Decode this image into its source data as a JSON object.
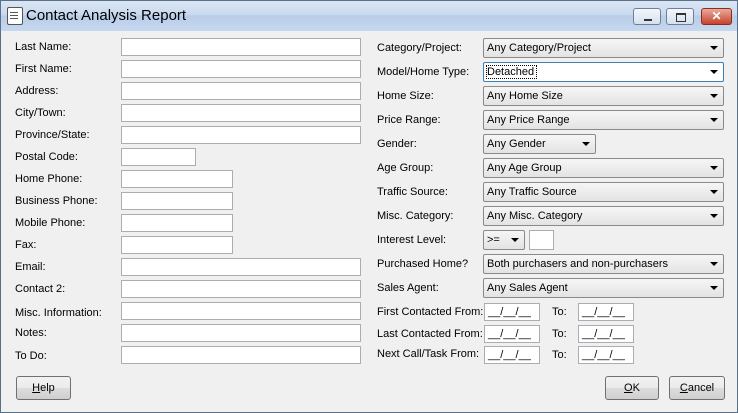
{
  "window": {
    "title": "Contact Analysis Report",
    "close_glyph": "✕"
  },
  "left_fields": {
    "last_name": {
      "label": "Last Name:",
      "value": ""
    },
    "first_name": {
      "label": "First Name:",
      "value": ""
    },
    "address": {
      "label": "Address:",
      "value": ""
    },
    "city": {
      "label": "City/Town:",
      "value": ""
    },
    "province": {
      "label": "Province/State:",
      "value": ""
    },
    "postal": {
      "label": "Postal Code:",
      "value": ""
    },
    "home_phone": {
      "label": "Home Phone:",
      "value": ""
    },
    "business_phone": {
      "label": "Business Phone:",
      "value": ""
    },
    "mobile_phone": {
      "label": "Mobile Phone:",
      "value": ""
    },
    "fax": {
      "label": "Fax:",
      "value": ""
    },
    "email": {
      "label": "Email:",
      "value": ""
    },
    "contact2": {
      "label": "Contact 2:",
      "value": ""
    },
    "misc_info": {
      "label": "Misc. Information:",
      "value": ""
    },
    "notes": {
      "label": "Notes:",
      "value": ""
    },
    "todo": {
      "label": "To Do:",
      "value": ""
    }
  },
  "right_fields": {
    "category": {
      "label": "Category/Project:",
      "value": "Any Category/Project"
    },
    "model": {
      "label": "Model/Home Type:",
      "value": "Detached"
    },
    "home_size": {
      "label": "Home Size:",
      "value": "Any Home Size"
    },
    "price_range": {
      "label": "Price Range:",
      "value": "Any Price Range"
    },
    "gender": {
      "label": "Gender:",
      "value": "Any Gender"
    },
    "age_group": {
      "label": "Age Group:",
      "value": "Any Age Group"
    },
    "traffic_source": {
      "label": "Traffic Source:",
      "value": "Any Traffic Source"
    },
    "misc_category": {
      "label": "Misc. Category:",
      "value": "Any Misc. Category"
    },
    "interest_level": {
      "label": "Interest Level:",
      "operator": ">=",
      "value": ""
    },
    "purchased": {
      "label": "Purchased Home?",
      "value": "Both purchasers and non-purchasers"
    },
    "sales_agent": {
      "label": "Sales Agent:",
      "value": "Any Sales Agent"
    }
  },
  "date_ranges": {
    "to_label": "To:",
    "first_contacted": {
      "label": "First Contacted From:",
      "from": "__/__/__",
      "to": "__/__/__"
    },
    "last_contacted": {
      "label": "Last Contacted From:",
      "from": "__/__/__",
      "to": "__/__/__"
    },
    "next_call": {
      "label": "Next Call/Task From:",
      "from": "__/__/__",
      "to": "__/__/__"
    }
  },
  "buttons": {
    "help": {
      "mnemonic": "H",
      "rest": "elp"
    },
    "ok": {
      "mnemonic": "O",
      "rest": "K"
    },
    "cancel": {
      "mnemonic": "C",
      "rest": "ancel"
    }
  }
}
